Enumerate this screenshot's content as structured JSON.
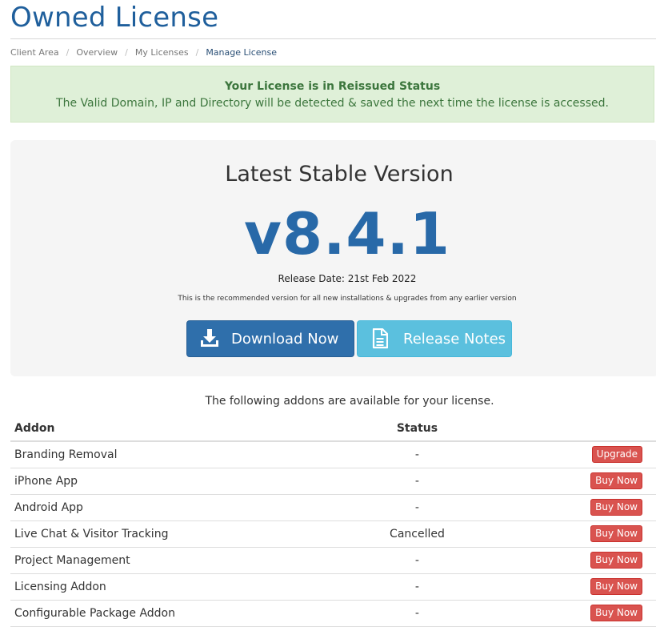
{
  "page": {
    "title": "Owned License"
  },
  "breadcrumb": {
    "items": [
      "Client Area",
      "Overview",
      "My Licenses",
      "Manage License"
    ],
    "separator": "/"
  },
  "alert": {
    "title": "Your License is in Reissued Status",
    "text": "The Valid Domain, IP and Directory will be detected & saved the next time the license is accessed."
  },
  "release": {
    "heading": "Latest Stable Version",
    "version": "v8.4.1",
    "date": "Release Date: 21st Feb 2022",
    "note": "This is the recommended version for all new installations & upgrades from any earlier version",
    "download_label": "Download Now",
    "notes_label": "Release Notes"
  },
  "addons": {
    "intro": "The following addons are available for your license.",
    "columns": {
      "addon": "Addon",
      "status": "Status",
      "action": ""
    },
    "rows": [
      {
        "name": "Branding Removal",
        "status": "-",
        "action": "Upgrade"
      },
      {
        "name": "iPhone App",
        "status": "-",
        "action": "Buy Now"
      },
      {
        "name": "Android App",
        "status": "-",
        "action": "Buy Now"
      },
      {
        "name": "Live Chat & Visitor Tracking",
        "status": "Cancelled",
        "action": "Buy Now"
      },
      {
        "name": "Project Management",
        "status": "-",
        "action": "Buy Now"
      },
      {
        "name": "Licensing Addon",
        "status": "-",
        "action": "Buy Now"
      },
      {
        "name": "Configurable Package Addon",
        "status": "-",
        "action": "Buy Now"
      }
    ]
  },
  "colors": {
    "brand": "#1f5f9c",
    "primary_button": "#2f6fab",
    "info_button": "#5bc0de",
    "danger_button": "#d9534f",
    "success_alert_bg": "#dff0d8",
    "success_alert_text": "#3c763d"
  },
  "icons": {
    "download": "download-icon",
    "notes": "document-icon"
  }
}
